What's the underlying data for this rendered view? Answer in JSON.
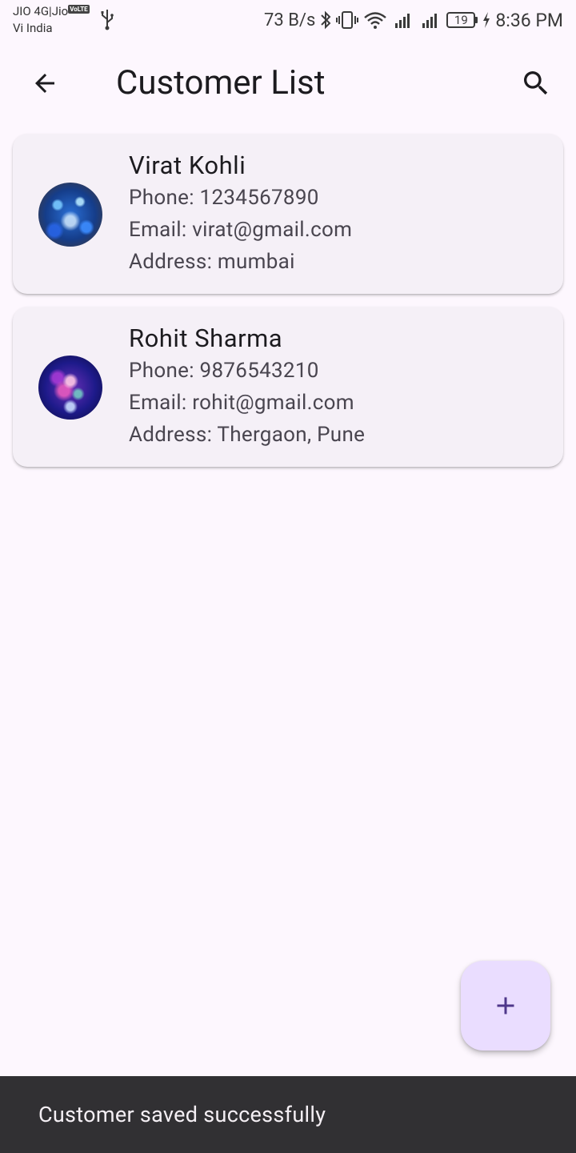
{
  "status_bar": {
    "carrier_line1": "JIO 4G|Jio",
    "volte_badge": "VoLTE",
    "carrier_line2": "Vi India",
    "net_speed": "73 B/s",
    "battery_level": "19",
    "time": "8:36 PM"
  },
  "app_bar": {
    "title": "Customer List"
  },
  "customers": [
    {
      "name": "Virat Kohli",
      "phone": "Phone: 1234567890",
      "email": "Email: virat@gmail.com",
      "address": "Address: mumbai"
    },
    {
      "name": "Rohit Sharma",
      "phone": "Phone: 9876543210",
      "email": "Email: rohit@gmail.com",
      "address": "Address: Thergaon, Pune"
    }
  ],
  "snackbar": {
    "message": "Customer saved successfully"
  },
  "colors": {
    "background": "#FDF7FE",
    "card": "#F5F0F7",
    "fab": "#EADDFF",
    "fab_icon": "#4F378B",
    "snackbar": "#313033"
  }
}
